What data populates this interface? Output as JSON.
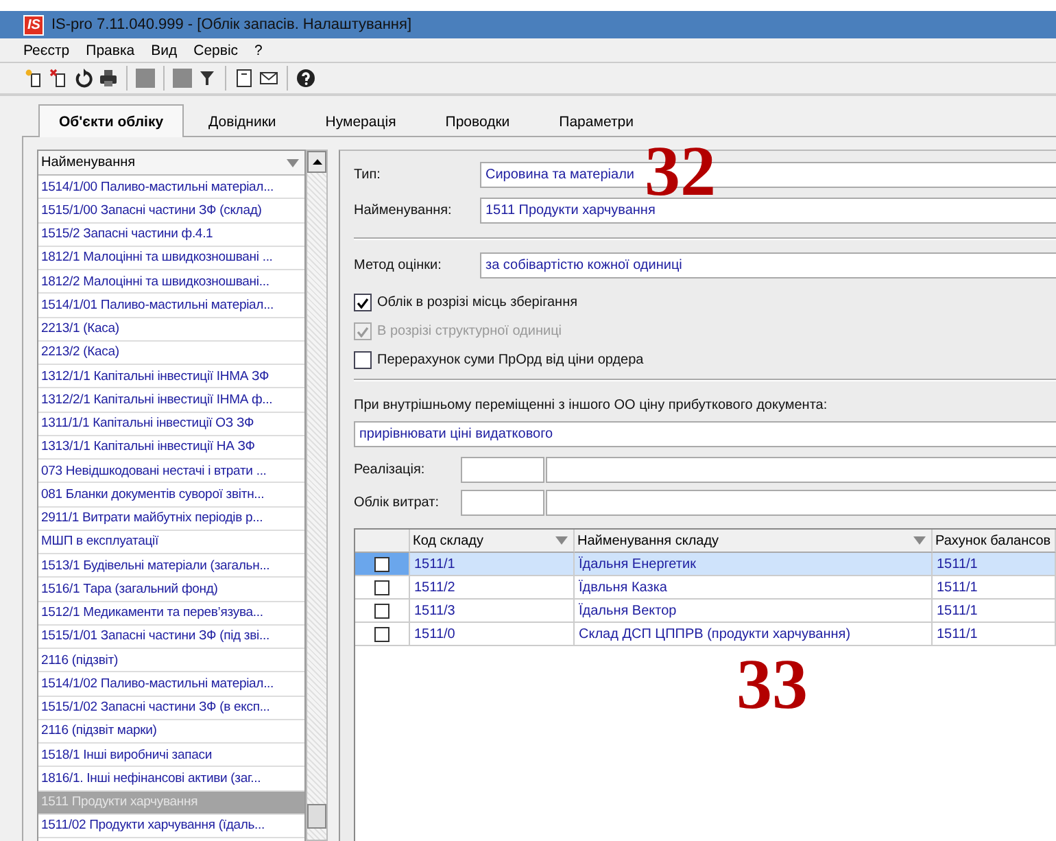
{
  "window": {
    "title": "IS-pro 7.11.040.999 - [Облік запасів. Налаштування]",
    "logo": "IS"
  },
  "menu": [
    "Реєстр",
    "Правка",
    "Вид",
    "Сервіс",
    "?"
  ],
  "tabs": [
    {
      "label": "Об'єкти обліку",
      "selected": true
    },
    {
      "label": "Довідники",
      "selected": false
    },
    {
      "label": "Нумерація",
      "selected": false
    },
    {
      "label": "Проводки",
      "selected": false
    },
    {
      "label": "Параметри",
      "selected": false
    }
  ],
  "list": {
    "header": "Найменування",
    "items": [
      {
        "label": "1514/1/00 Паливо-мастильні матеріал...",
        "selected": false
      },
      {
        "label": "1515/1/00 Запасні частини ЗФ (склад)",
        "selected": false
      },
      {
        "label": "1515/2 Запасні частини ф.4.1",
        "selected": false
      },
      {
        "label": "1812/1 Малоцінні та швидкозношвані ...",
        "selected": false
      },
      {
        "label": "1812/2  Малоцінні та швидкозношвані...",
        "selected": false
      },
      {
        "label": "1514/1/01 Паливо-мастильні матеріал...",
        "selected": false
      },
      {
        "label": "2213/1 (Каса)",
        "selected": false
      },
      {
        "label": "2213/2 (Каса)",
        "selected": false
      },
      {
        "label": "1312/1/1 Капітальні інвестиції ІНМА ЗФ",
        "selected": false
      },
      {
        "label": "1312/2/1 Капітальні інвестиції ІНМА ф...",
        "selected": false
      },
      {
        "label": "1311/1/1 Капітальні інвестиції ОЗ ЗФ",
        "selected": false
      },
      {
        "label": "1313/1/1 Капітальні інвестиції НА ЗФ",
        "selected": false
      },
      {
        "label": "073 Невідшкодовані нестачі і втрати ...",
        "selected": false
      },
      {
        "label": "081 Бланки документів суворої звітн...",
        "selected": false
      },
      {
        "label": "2911/1 Витрати майбутніх періодів р...",
        "selected": false
      },
      {
        "label": "МШП в експлуатації",
        "selected": false
      },
      {
        "label": "1513/1 Будівельні матеріали (загальн...",
        "selected": false
      },
      {
        "label": "1516/1 Тара (загальний фонд)",
        "selected": false
      },
      {
        "label": "1512/1 Медикаменти та перев’язува...",
        "selected": false
      },
      {
        "label": "1515/1/01 Запасні частини ЗФ (під зві...",
        "selected": false
      },
      {
        "label": "2116 (підзвіт)",
        "selected": false
      },
      {
        "label": "1514/1/02 Паливо-мастильні матеріал...",
        "selected": false
      },
      {
        "label": "1515/1/02 Запасні частини ЗФ (в експ...",
        "selected": false
      },
      {
        "label": "2116 (підзвіт марки)",
        "selected": false
      },
      {
        "label": "1518/1 Інші виробничі запаси",
        "selected": false
      },
      {
        "label": "1816/1. Інші нефінансові активи (заг...",
        "selected": false
      },
      {
        "label": "1511 Продукти харчування",
        "selected": true
      },
      {
        "label": "1511/02 Продукти харчування (їдаль...",
        "selected": false
      }
    ]
  },
  "form": {
    "fields_top": [
      {
        "label": "Тип:",
        "value": "Сировина та матеріали"
      },
      {
        "label": "Найменування:",
        "value": "1511 Продукти харчування"
      }
    ],
    "method": {
      "label": "Метод оцінки:",
      "value": "за собівартістю кожної одиниці"
    },
    "checkboxes": [
      {
        "label": "Облік в розрізі місць зберігання",
        "checked": true,
        "disabled": false
      },
      {
        "label": "В розрізі структурної одиниці",
        "checked": true,
        "disabled": true
      },
      {
        "label": "Перерахунок суми ПрОрд від ціни ордера",
        "checked": false,
        "disabled": false
      }
    ],
    "transfer": {
      "label": "При внутрішньому переміщенні з іншого ОО ціну прибуткового документа:",
      "value": "прирівнювати ціні видаткового"
    },
    "pairs": [
      {
        "label": "Реалізація:"
      },
      {
        "label": "Облік витрат:"
      }
    ]
  },
  "table": {
    "columns": [
      "Код складу",
      "Найменування складу",
      "Рахунок балансов"
    ],
    "rows": [
      {
        "selected": true,
        "checked": false,
        "cells": [
          "1511/1",
          "Їдальня Енергетик",
          "1511/1"
        ]
      },
      {
        "selected": false,
        "checked": false,
        "cells": [
          "1511/2",
          "Їдвльня Казка",
          "1511/1"
        ]
      },
      {
        "selected": false,
        "checked": false,
        "cells": [
          "1511/3",
          "Їдальня Вектор",
          "1511/1"
        ]
      },
      {
        "selected": false,
        "checked": false,
        "cells": [
          "1511/0",
          "Склад ДСП ЦППРВ (продукти харчування)",
          "1511/1"
        ]
      }
    ]
  },
  "annotations": [
    "32",
    "33"
  ]
}
